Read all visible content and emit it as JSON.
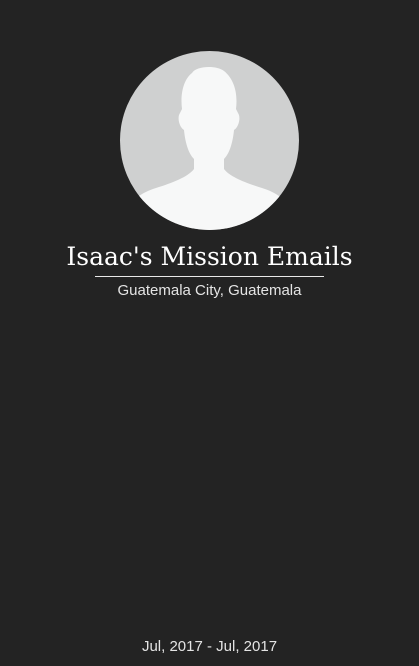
{
  "profile": {
    "avatar_icon": "default-user-silhouette-icon",
    "title": "Isaac's Mission Emails",
    "location": "Guatemala City, Guatemala"
  },
  "footer": {
    "date_range": "Jul, 2017 - Jul, 2017"
  },
  "colors": {
    "background": "#232323",
    "avatar_background": "#cfd0d0",
    "avatar_silhouette": "#f7f8f8",
    "text": "#ffffff"
  }
}
